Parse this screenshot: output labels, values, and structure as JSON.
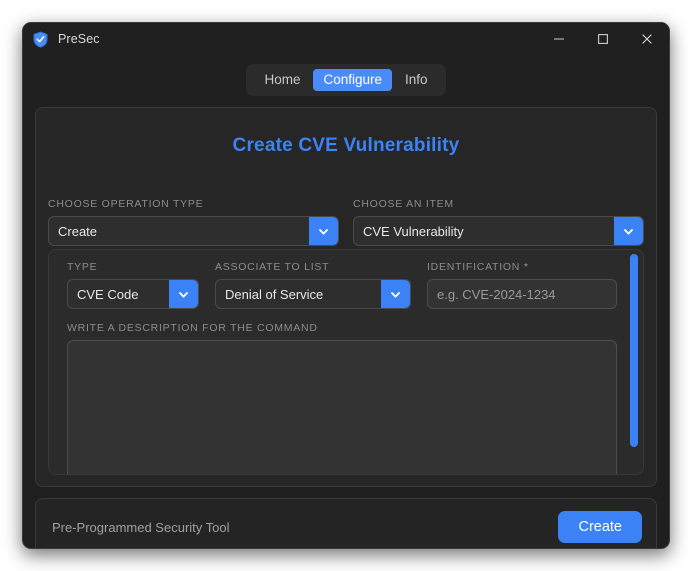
{
  "window": {
    "app_icon": "shield-check-icon",
    "title": "PreSec",
    "controls": {
      "minimize": "minimize-icon",
      "maximize": "maximize-icon",
      "close": "close-icon"
    }
  },
  "nav": {
    "tabs": [
      {
        "label": "Home",
        "active": false
      },
      {
        "label": "Configure",
        "active": true
      },
      {
        "label": "Info",
        "active": false
      }
    ]
  },
  "main": {
    "page_title": "Create CVE Vulnerability",
    "operation_type": {
      "label": "CHOOSE OPERATION TYPE",
      "value": "Create",
      "arrow_icon": "chevron-down-icon"
    },
    "item": {
      "label": "CHOOSE AN ITEM",
      "value": "CVE Vulnerability",
      "arrow_icon": "chevron-down-icon"
    },
    "type": {
      "label": "TYPE",
      "value": "CVE Code",
      "arrow_icon": "chevron-down-icon"
    },
    "associate_to_list": {
      "label": "ASSOCIATE TO LIST",
      "value": "Denial of Service",
      "arrow_icon": "chevron-down-icon"
    },
    "identification": {
      "label": "IDENTIFICATION",
      "required_marker": "*",
      "value": "",
      "placeholder": "e.g. CVE-2024-1234"
    },
    "description": {
      "label": "WRITE A DESCRIPTION FOR THE COMMAND",
      "value": "",
      "placeholder": ""
    }
  },
  "footer": {
    "text": "Pre-Programmed Security Tool",
    "create_label": "Create"
  },
  "colors": {
    "accent": "#3b82f6",
    "tab_active": "#4a8cf7",
    "title_text": "#3c83f6",
    "window_bg": "#1f1f1f",
    "card_bg": "#262626",
    "panel_bg": "#2b2b2b"
  }
}
